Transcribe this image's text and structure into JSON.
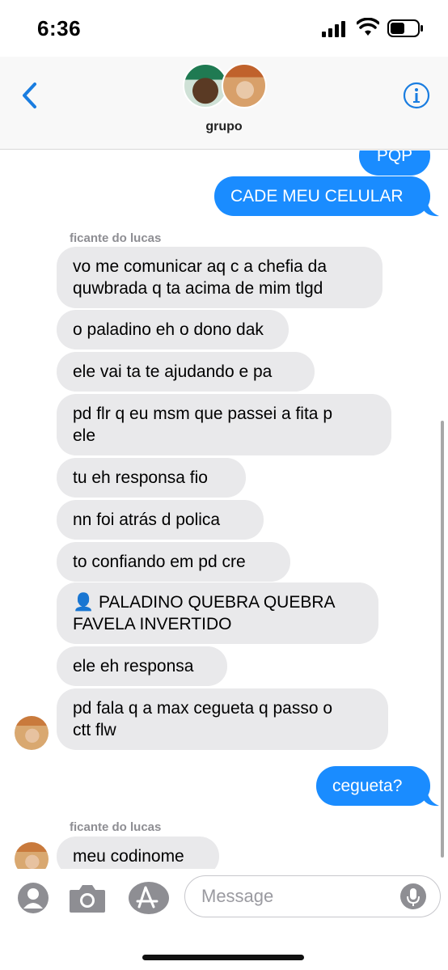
{
  "status_bar": {
    "time": "6:36"
  },
  "header": {
    "group_name": "grupo"
  },
  "messages": [
    {
      "text": "PQP",
      "direction": "out"
    },
    {
      "text": "CADE MEU CELULAR",
      "direction": "out"
    },
    {
      "sender": "ficante do lucas"
    },
    {
      "text": "vo me comunicar aq c a chefia da\nquwbrada q ta acima de mim tlgd",
      "direction": "in"
    },
    {
      "text": "o paladino eh o dono dak",
      "direction": "in"
    },
    {
      "text": "ele vai ta te ajudando e pa",
      "direction": "in"
    },
    {
      "text": "pd flr q eu msm que passei a fita p\nele",
      "direction": "in"
    },
    {
      "text": "tu eh responsa fio",
      "direction": "in"
    },
    {
      "text": "nn foi atrás d polica",
      "direction": "in"
    },
    {
      "text": "to confiando em pd cre",
      "direction": "in"
    },
    {
      "text": "👤 PALADINO QUEBRA QUEBRA\nFAVELA INVERTIDO",
      "direction": "in"
    },
    {
      "text": "ele eh responsa",
      "direction": "in"
    },
    {
      "text": "pd fala q a max cegueta q passo o\nctt flw",
      "direction": "in"
    },
    {
      "text": "cegueta?",
      "direction": "out"
    },
    {
      "sender": "ficante do lucas"
    },
    {
      "text": "meu codinome",
      "direction": "in"
    }
  ],
  "composer": {
    "placeholder": "Message"
  },
  "colors": {
    "outgoing": "#1a8cff",
    "incoming": "#e9e9eb",
    "accent": "#1a7de0"
  },
  "icons": [
    "back-chevron-icon",
    "info-icon",
    "memoji-icon",
    "camera-icon",
    "app-store-icon",
    "microphone-icon",
    "signal-icon",
    "wifi-icon",
    "battery-icon"
  ]
}
